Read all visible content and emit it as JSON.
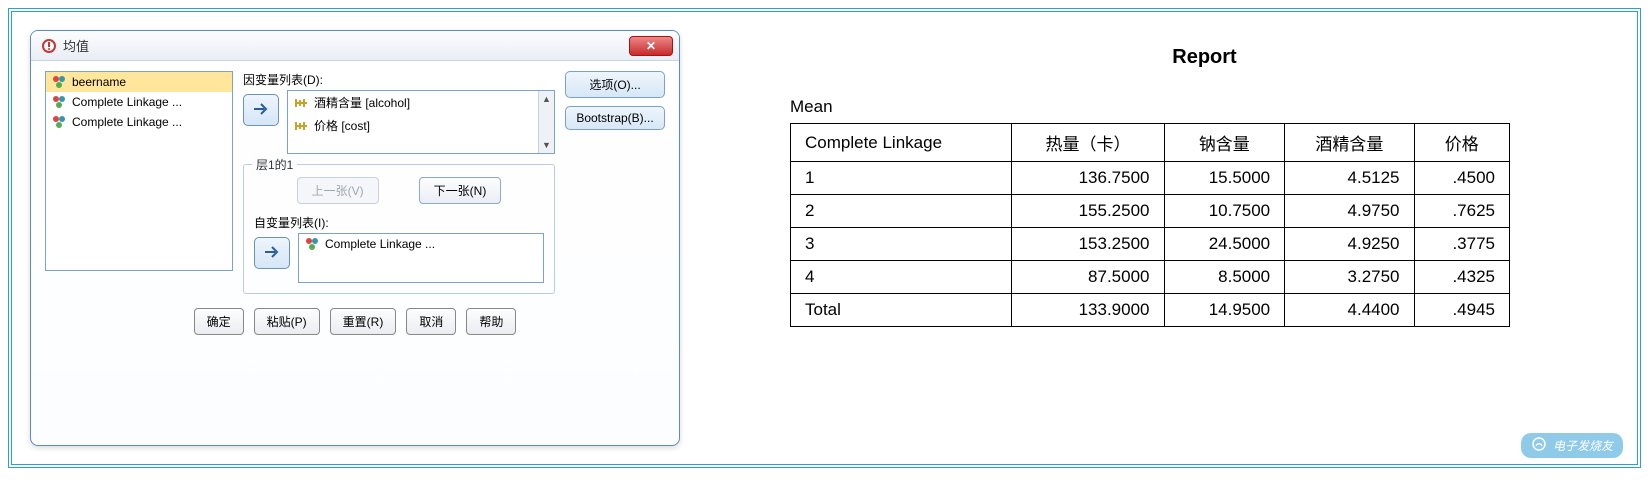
{
  "dialog": {
    "title": "均值",
    "close_glyph": "✕",
    "source_vars": [
      {
        "label": "beername",
        "icon": "nominal",
        "selected": true
      },
      {
        "label": "Complete Linkage  ...",
        "icon": "nominal",
        "selected": false
      },
      {
        "label": "Complete Linkage  ...",
        "icon": "nominal",
        "selected": false
      }
    ],
    "dependent_label": "因变量列表(D):",
    "dependent_vars": [
      {
        "label": "酒精含量 [alcohol]",
        "icon": "scale"
      },
      {
        "label": "价格 [cost]",
        "icon": "scale"
      }
    ],
    "layer": {
      "legend": "层1的1",
      "prev_label": "上一张(V)",
      "next_label": "下一张(N)",
      "indep_label": "自变量列表(I):",
      "indep_vars": [
        {
          "label": "Complete Linkage  ...",
          "icon": "nominal"
        }
      ]
    },
    "side_buttons": {
      "options": "选项(O)...",
      "bootstrap": "Bootstrap(B)..."
    },
    "bottom_buttons": {
      "ok": "确定",
      "paste": "粘贴(P)",
      "reset": "重置(R)",
      "cancel": "取消",
      "help": "帮助"
    }
  },
  "report": {
    "title": "Report",
    "mean_label": "Mean",
    "columns": [
      "Complete Linkage",
      "热量（卡）",
      "钠含量",
      "酒精含量",
      "价格"
    ],
    "rows": [
      {
        "label": "1",
        "values": [
          "136.7500",
          "15.5000",
          "4.5125",
          ".4500"
        ]
      },
      {
        "label": "2",
        "values": [
          "155.2500",
          "10.7500",
          "4.9750",
          ".7625"
        ]
      },
      {
        "label": "3",
        "values": [
          "153.2500",
          "24.5000",
          "4.9250",
          ".3775"
        ]
      },
      {
        "label": "4",
        "values": [
          "87.5000",
          "8.5000",
          "3.2750",
          ".4325"
        ]
      },
      {
        "label": "Total",
        "values": [
          "133.9000",
          "14.9500",
          "4.4400",
          ".4945"
        ]
      }
    ]
  },
  "watermark_text": "电子发烧友",
  "chart_data": {
    "type": "table",
    "title": "Report – Mean",
    "grouping": "Complete Linkage",
    "columns": [
      "热量（卡）",
      "钠含量",
      "酒精含量",
      "价格"
    ],
    "categories": [
      "1",
      "2",
      "3",
      "4",
      "Total"
    ],
    "series": [
      {
        "name": "热量（卡）",
        "values": [
          136.75,
          155.25,
          153.25,
          87.5,
          133.9
        ]
      },
      {
        "name": "钠含量",
        "values": [
          15.5,
          10.75,
          24.5,
          8.5,
          14.95
        ]
      },
      {
        "name": "酒精含量",
        "values": [
          4.5125,
          4.975,
          4.925,
          3.275,
          4.44
        ]
      },
      {
        "name": "价格",
        "values": [
          0.45,
          0.7625,
          0.3775,
          0.4325,
          0.4945
        ]
      }
    ]
  }
}
